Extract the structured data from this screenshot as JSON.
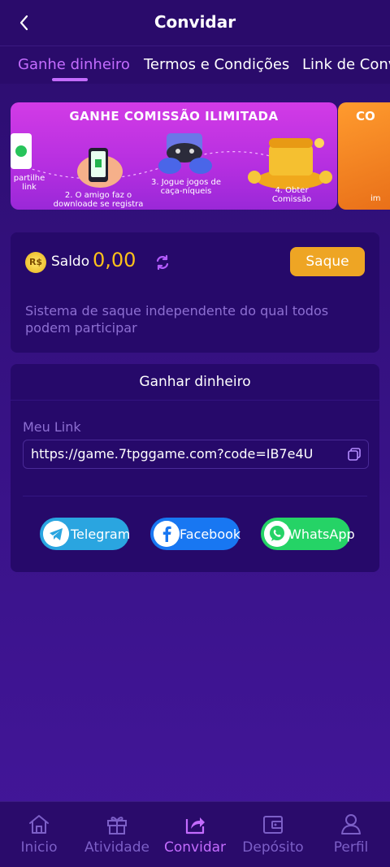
{
  "header": {
    "title": "Convidar"
  },
  "tabs": [
    {
      "label": "Ganhe dinheiro"
    },
    {
      "label": "Termos e Condições"
    },
    {
      "label": "Link de Convi"
    }
  ],
  "banner": {
    "title": "GANHE COMISSÃO ILIMITADA",
    "steps": [
      "partilhe\nlink",
      "2. O amigo faz o\ndownloade se registra",
      "3. Jogue jogos de\ncaça-níqueis",
      "4. Obter\nComissão"
    ],
    "next_title": "CO",
    "next_sub": "im"
  },
  "balance": {
    "currency_badge": "R$",
    "label": "Saldo",
    "value": "0,00",
    "withdraw_label": "Saque",
    "description": "Sistema de saque independente do qual todos podem participar"
  },
  "earn": {
    "title": "Ganhar dinheiro",
    "link_label": "Meu Link",
    "link": "https://game.7tpggame.com?code=IB7e4U",
    "share": [
      {
        "label": "Telegram",
        "icon": "telegram-icon",
        "color": "#2aa5e0"
      },
      {
        "label": "Facebook",
        "icon": "facebook-icon",
        "color": "#1877f2"
      },
      {
        "label": "WhatsApp",
        "icon": "whatsapp-icon",
        "color": "#25d366"
      }
    ]
  },
  "nav": [
    {
      "label": "Inicio",
      "icon": "home-icon"
    },
    {
      "label": "Atividade",
      "icon": "gift-icon"
    },
    {
      "label": "Convidar",
      "icon": "share-icon"
    },
    {
      "label": "Depósito",
      "icon": "wallet-icon"
    },
    {
      "label": "Perfil",
      "icon": "user-icon"
    }
  ],
  "colors": {
    "accent": "#c46cff",
    "gold": "#ffc21a",
    "button": "#eea524",
    "background": "#2b0d6e"
  }
}
